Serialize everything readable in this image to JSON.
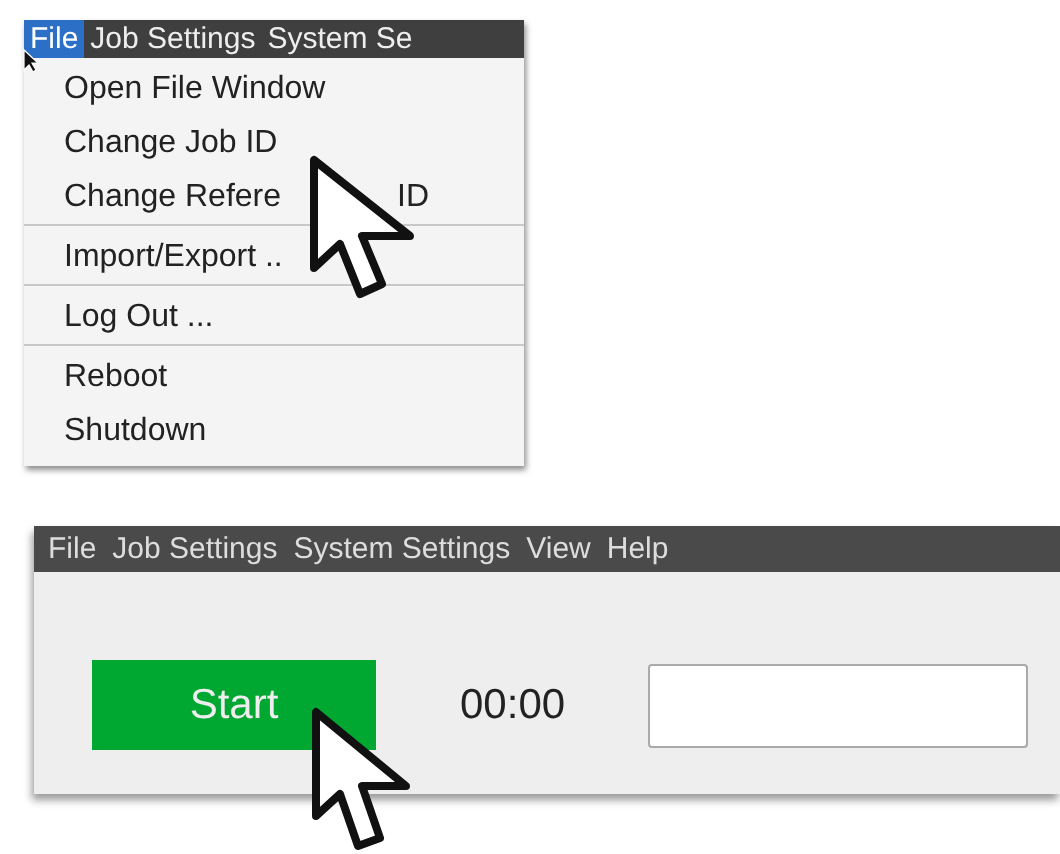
{
  "menu_screenshot": {
    "menubar": [
      {
        "label": "File",
        "selected": true
      },
      {
        "label": "Job Settings",
        "selected": false
      },
      {
        "label": "System Se",
        "selected": false
      }
    ],
    "menu_items": [
      {
        "label": "Open File Window",
        "separator_after": false
      },
      {
        "label": "Change Job ID",
        "separator_after": false
      },
      {
        "label": "Change Refere",
        "label_tail": "ID",
        "separator_after": true
      },
      {
        "label": "Import/Export ..",
        "separator_after": true
      },
      {
        "label": "Log Out ...",
        "separator_after": true
      },
      {
        "label": "Reboot",
        "separator_after": false
      },
      {
        "label": "Shutdown",
        "separator_after": false
      }
    ]
  },
  "toolbar_screenshot": {
    "menubar": [
      {
        "label": "File"
      },
      {
        "label": "Job Settings"
      },
      {
        "label": "System Settings"
      },
      {
        "label": "View"
      },
      {
        "label": "Help"
      }
    ],
    "start_button": "Start",
    "timer": "00:00"
  }
}
